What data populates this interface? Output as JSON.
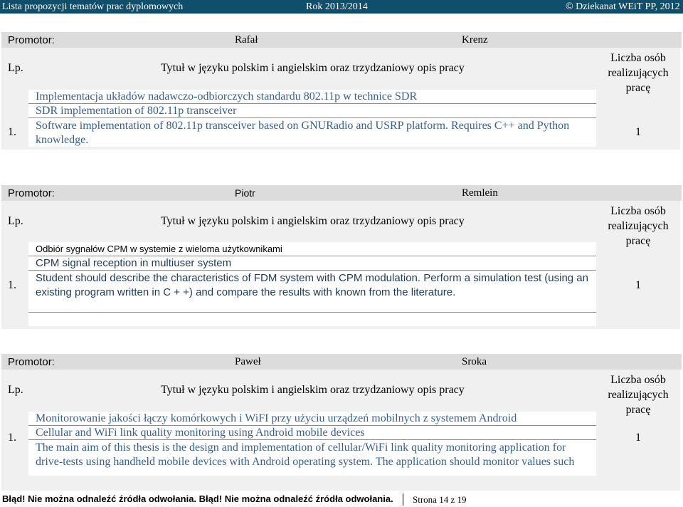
{
  "header": {
    "left": "Lista propozycji tematów prac dyplomowych",
    "center": "Rok 2013/2014",
    "right": "© Dziekanat WEiT PP, 2012"
  },
  "table_headers": {
    "lp": "Lp.",
    "title": "Tytuł w języku polskim i angielskim oraz trzydzaniowy opis pracy",
    "count_line1": "Liczba osób",
    "count_line2": "realizujących",
    "count_line3": "pracę"
  },
  "sections": [
    {
      "promotor_label": "Promotor:",
      "first_name": "Rafał",
      "last_name": "Krenz",
      "number": "1.",
      "count": "1",
      "title_pl": "Implementacja układów nadawczo-odbiorczych standardu 802.11p w technice SDR",
      "title_en": "SDR implementation of 802.11p transceiver",
      "desc_line1": "Software implementation of 802.11p transceiver based on GNURadio and USRP platform. Requires C++ and Python",
      "desc_line2": "knowledge."
    },
    {
      "promotor_label": "Promotor:",
      "first_name": "Piotr",
      "last_name": "Remlein",
      "number": "1.",
      "count": "1",
      "title_pl": "Odbiór sygnałów CPM w systemie z wieloma użytkownikami",
      "title_en": "CPM signal reception in multiuser system",
      "desc_line1": "Student should describe the characteristics of FDM system with CPM modulation. Perform a simulation test (using an",
      "desc_line2": "existing program written in C + +) and compare the results with known from the literature."
    },
    {
      "promotor_label": "Promotor:",
      "first_name": "Paweł",
      "last_name": "Sroka",
      "number": "1.",
      "count": "1",
      "title_pl": "Monitorowanie jakości łączy komórkowych i WiFI przy użyciu urządzeń mobilnych z systemem Android",
      "title_en": "Cellular and WiFi link quality monitoring using Android mobile devices",
      "desc_line1": "The main aim of this thesis is the design and implementation of cellular/WiFi link quality monitoring application for",
      "desc_line2": "drive-tests using handheld mobile devices with Android operating system. The application should monitor values such"
    }
  ],
  "footer": {
    "error": "Błąd! Nie można odnaleźć źródła odwołania. Błąd! Nie można odnaleźć źródła odwołania.",
    "page": "Strona 14 z 19"
  }
}
